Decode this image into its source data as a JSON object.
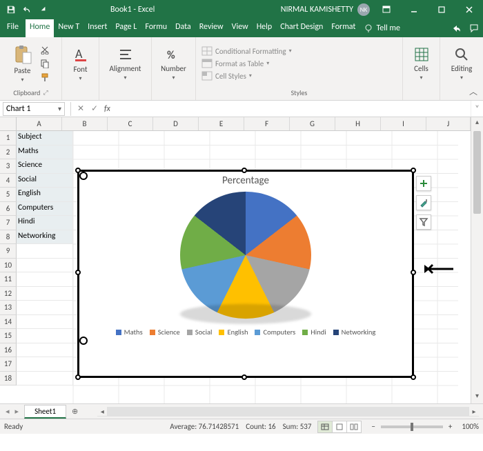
{
  "titlebar": {
    "doc_title": "Book1 - Excel",
    "user_name": "NIRMAL KAMISHETTY",
    "user_initials": "NK"
  },
  "tabs": {
    "file": "File",
    "home": "Home",
    "newtab": "New T",
    "insert": "Insert",
    "pagelayout": "Page L",
    "formulas": "Formu",
    "data": "Data",
    "review": "Review",
    "view": "View",
    "help": "Help",
    "chartdesign": "Chart Design",
    "format": "Format",
    "tellme": "Tell me"
  },
  "ribbon": {
    "clipboard": {
      "paste": "Paste",
      "label": "Clipboard"
    },
    "font": {
      "btn": "Font",
      "label": "Font"
    },
    "alignment": {
      "btn": "Alignment",
      "label": "Alignment"
    },
    "number": {
      "btn": "Number",
      "label": "Number"
    },
    "styles": {
      "cond": "Conditional Formatting",
      "table": "Format as Table",
      "cell": "Cell Styles",
      "label": "Styles"
    },
    "cells": {
      "btn": "Cells",
      "label": "Cells"
    },
    "editing": {
      "btn": "Editing",
      "label": "Editing"
    }
  },
  "namebox": "Chart 1",
  "columns": [
    "A",
    "B",
    "C",
    "D",
    "E",
    "F",
    "G",
    "H",
    "I",
    "J"
  ],
  "rows": [
    "1",
    "2",
    "3",
    "4",
    "5",
    "6",
    "7",
    "8",
    "9",
    "10",
    "11",
    "12",
    "13",
    "14",
    "15",
    "16",
    "17",
    "18"
  ],
  "cells_colA": [
    "Subject",
    "Maths",
    "Science",
    "Social",
    "English",
    "Computers",
    "Hindi",
    "Networking"
  ],
  "chart": {
    "title": "Percentage",
    "legend": [
      "Maths",
      "Science",
      "Social",
      "English",
      "Computers",
      "Hindi",
      "Networking"
    ],
    "colors": {
      "Maths": "#4472c4",
      "Science": "#ed7d31",
      "Social": "#a5a5a5",
      "English": "#ffc000",
      "Computers": "#5b9bd5",
      "Hindi": "#70ad47",
      "Networking": "#264478"
    }
  },
  "sheets": {
    "active": "Sheet1"
  },
  "status": {
    "ready": "Ready",
    "average_label": "Average:",
    "average": "76.71428571",
    "count_label": "Count:",
    "count": "16",
    "sum_label": "Sum:",
    "sum": "537",
    "zoom": "100%"
  },
  "chart_data": {
    "type": "pie",
    "title": "Percentage",
    "categories": [
      "Maths",
      "Science",
      "Social",
      "English",
      "Computers",
      "Hindi",
      "Networking"
    ],
    "values": [
      76.7,
      76.7,
      76.7,
      76.7,
      76.7,
      76.7,
      76.7
    ],
    "total": 537
  }
}
